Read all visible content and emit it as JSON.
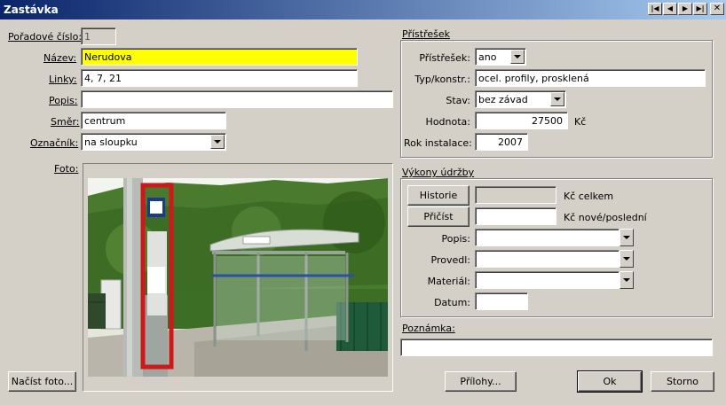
{
  "window": {
    "title": "Zastávka",
    "controls": [
      "|◀",
      "◀",
      "▶",
      "▶|"
    ],
    "close": "✕"
  },
  "left": {
    "poradove_label": "Pořadové číslo:",
    "poradove_value": "1",
    "nazev_label": "Název:",
    "nazev_value": "Nerudova",
    "linky_label": "Linky:",
    "linky_value": "4, 7, 21",
    "popis_label": "Popis:",
    "popis_value": "",
    "smer_label": "Směr:",
    "smer_value": "centrum",
    "oznacnik_label": "Označník:",
    "oznacnik_value": "na sloupku",
    "foto_label": "Foto:",
    "nacist_button": "Načíst foto..."
  },
  "pristresek": {
    "group_label": "Přístřešek",
    "pristresek_label": "Přístřešek:",
    "pristresek_value": "ano",
    "typ_label": "Typ/konstr.:",
    "typ_value": "ocel. profily, prosklená",
    "stav_label": "Stav:",
    "stav_value": "bez závad",
    "hodnota_label": "Hodnota:",
    "hodnota_value": "27500",
    "hodnota_unit": "Kč",
    "rok_label": "Rok instalace:",
    "rok_value": "2007"
  },
  "udrzba": {
    "group_label": "Výkony údržby",
    "historie_button": "Historie",
    "historie_value": "",
    "historie_unit": "Kč celkem",
    "pricist_button": "Přičíst",
    "pricist_value": "",
    "pricist_unit": "Kč nové/poslední",
    "popis_label": "Popis:",
    "popis_value": "",
    "provedl_label": "Provedl:",
    "provedl_value": "",
    "material_label": "Materiál:",
    "material_value": "",
    "datum_label": "Datum:",
    "datum_value": ""
  },
  "poznamka": {
    "label": "Poznámka:",
    "value": ""
  },
  "buttons": {
    "prilohy": "Přílohy...",
    "ok": "Ok",
    "storno": "Storno"
  }
}
